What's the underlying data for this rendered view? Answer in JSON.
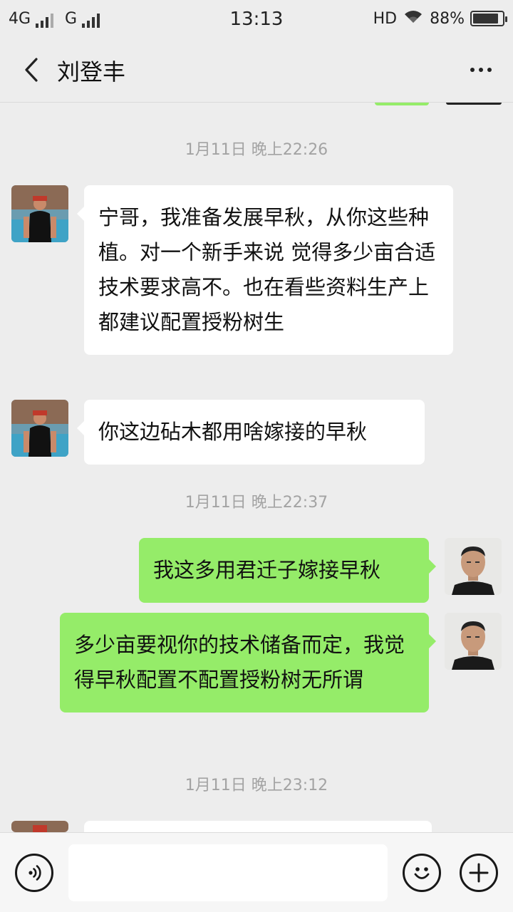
{
  "status_bar": {
    "network_1": "4G",
    "network_2": "G",
    "time": "13:13",
    "hd": "HD",
    "battery_text": "88%",
    "battery_level": 0.88
  },
  "header": {
    "title": "刘登丰",
    "back_icon": "chevron-left-icon",
    "more_icon": "more-dots-icon"
  },
  "messages": {
    "ts1": "1月11日 晚上22:26",
    "m1": "宁哥，我准备发展早秋，从你这些种植。对一个新手来说 觉得多少亩合适  技术要求高不。也在看些资料生产上 都建议配置授粉树生",
    "m2": "你这边砧木都用啥嫁接的早秋",
    "ts2": "1月11日 晚上22:37",
    "m3": "我这多用君迁子嫁接早秋",
    "m4": "多少亩要视你的技术储备而定，我觉得早秋配置不配置授粉树无所谓",
    "ts3": "1月11日 晚上23:12"
  },
  "input_bar": {
    "voice_icon": "voice-icon",
    "emoji_icon": "emoji-icon",
    "plus_icon": "plus-icon",
    "text_value": ""
  },
  "colors": {
    "background": "#ededed",
    "bubble_sent": "#95ec69",
    "bubble_received": "#ffffff",
    "timestamp_text": "#a3a3a3"
  }
}
